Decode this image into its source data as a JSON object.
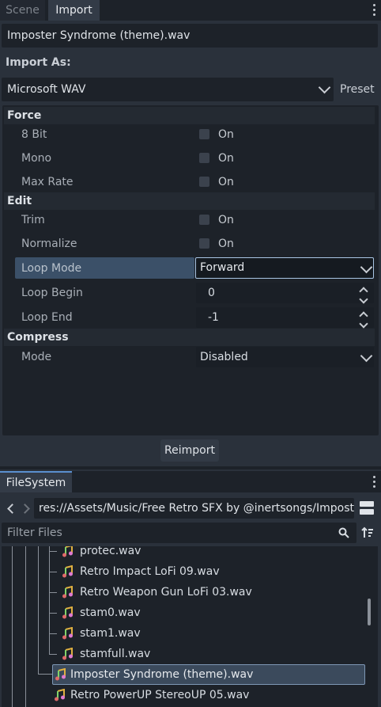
{
  "tabs": [
    {
      "label": "Scene",
      "active": false
    },
    {
      "label": "Import",
      "active": true
    }
  ],
  "import": {
    "file_name": "Imposter Syndrome (theme).wav",
    "import_as_label": "Import As:",
    "importer": "Microsoft WAV",
    "preset_label": "Preset",
    "sections": {
      "force": "Force",
      "edit": "Edit",
      "compress": "Compress"
    },
    "properties": {
      "bit8": {
        "label": "8 Bit",
        "value": "On",
        "checked": false
      },
      "mono": {
        "label": "Mono",
        "value": "On",
        "checked": false
      },
      "max_rate": {
        "label": "Max Rate",
        "value": "On",
        "checked": false
      },
      "trim": {
        "label": "Trim",
        "value": "On",
        "checked": false
      },
      "normalize": {
        "label": "Normalize",
        "value": "On",
        "checked": false
      },
      "loop_mode": {
        "label": "Loop Mode",
        "value": "Forward"
      },
      "loop_begin": {
        "label": "Loop Begin",
        "value": "0"
      },
      "loop_end": {
        "label": "Loop End",
        "value": "-1"
      },
      "mode": {
        "label": "Mode",
        "value": "Disabled"
      }
    },
    "reimport_label": "Reimport"
  },
  "filesystem": {
    "tab_label": "FileSystem",
    "path": "res://Assets/Music/Free Retro SFX by @inertsongs/Imposter",
    "filter_placeholder": "Filter Files",
    "files": [
      {
        "name": "protec.wav",
        "selected": false
      },
      {
        "name": "Retro Impact LoFi 09.wav",
        "selected": false
      },
      {
        "name": "Retro Weapon Gun LoFi 03.wav",
        "selected": false
      },
      {
        "name": "stam0.wav",
        "selected": false
      },
      {
        "name": "stam1.wav",
        "selected": false
      },
      {
        "name": "stamfull.wav",
        "selected": false
      },
      {
        "name": "Imposter Syndrome (theme).wav",
        "selected": true
      },
      {
        "name": "Retro PowerUP StereoUP 05.wav",
        "selected": false
      }
    ],
    "file_icon": "audio-file-icon"
  },
  "colors": {
    "accent": "#5a8fcf",
    "selected_row": "#3b5068",
    "audio_icon": "#e0b040"
  }
}
